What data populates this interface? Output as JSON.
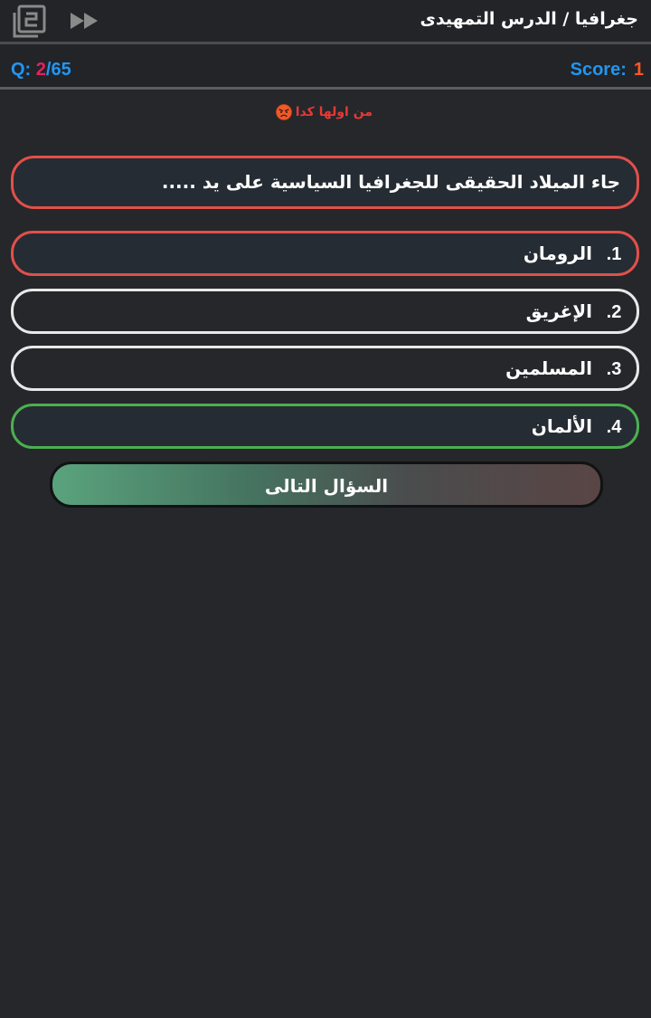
{
  "header": {
    "breadcrumb": "جغرافيا / الدرس التمهيدى",
    "numbered_list_icon": "numbered-list-icon",
    "skip_icon": "fast-forward-icon"
  },
  "status": {
    "question_prefix": "Q:",
    "question_current": "2",
    "question_total": "/65",
    "score_label": "Score:",
    "score_value": "1"
  },
  "feedback": {
    "message": "من اولها كدا",
    "icon": "angry-face-icon"
  },
  "question": {
    "text": "جاء الميلاد الحقيقى للجغرافيا السياسية على يد ....."
  },
  "options": [
    {
      "number": "1.",
      "label": "الرومان",
      "state": "wrong"
    },
    {
      "number": "2.",
      "label": "الإغريق",
      "state": "neutral"
    },
    {
      "number": "3.",
      "label": "المسلمين",
      "state": "neutral"
    },
    {
      "number": "4.",
      "label": "الألمان",
      "state": "correct"
    }
  ],
  "next_button": {
    "label": "السؤال التالى"
  },
  "colors": {
    "background": "#25272b",
    "wrong_border": "#e2504a",
    "correct_border": "#4caf50",
    "neutral_border": "#e8e8e8",
    "accent_blue": "#2196f3",
    "accent_pink": "#e91e63",
    "score_orange": "#ff5722"
  }
}
